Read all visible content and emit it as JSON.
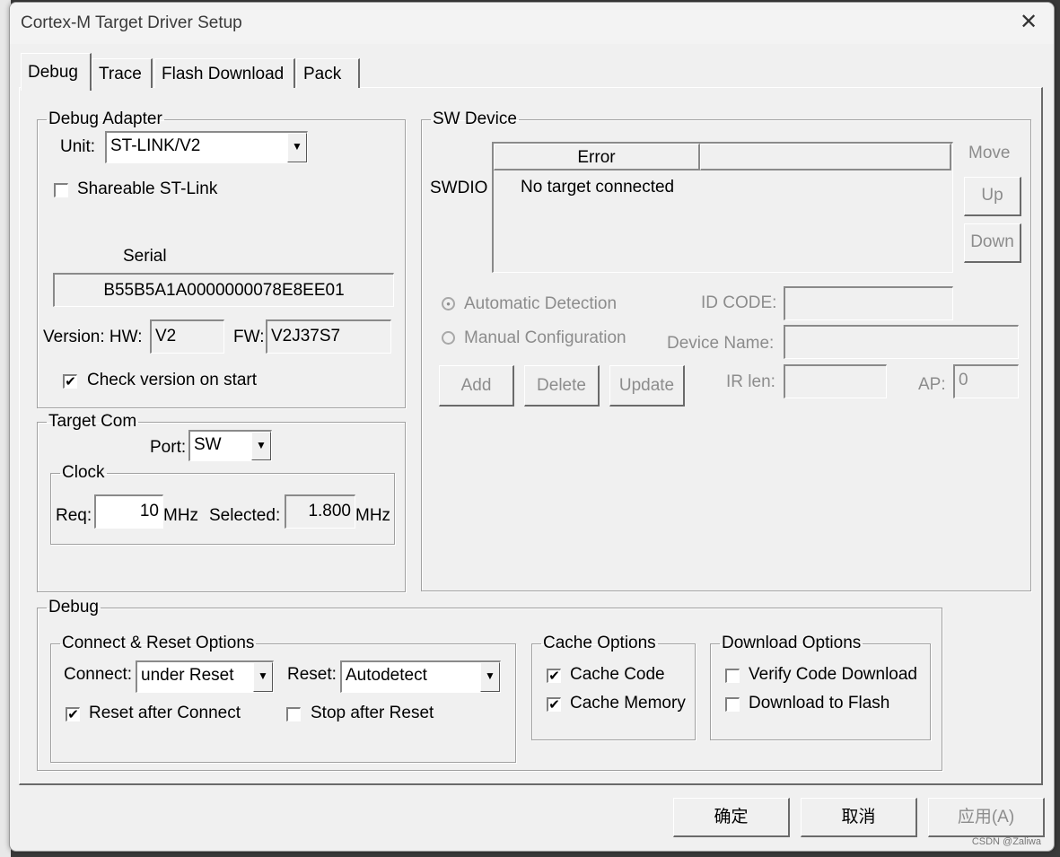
{
  "window": {
    "title": "Cortex-M Target Driver Setup"
  },
  "tabs": [
    {
      "label": "Debug",
      "active": true
    },
    {
      "label": "Trace",
      "active": false
    },
    {
      "label": "Flash Download",
      "active": false
    },
    {
      "label": "Pack",
      "active": false
    }
  ],
  "debug_adapter": {
    "legend": "Debug Adapter",
    "unit_label": "Unit:",
    "unit_value": "ST-LINK/V2",
    "shareable_label": "Shareable ST-Link",
    "shareable_checked": false,
    "serial_label": "Serial",
    "serial_value": "B55B5A1A0000000078E8EE01",
    "version_hw_label": "Version: HW:",
    "hw_value": "V2",
    "fw_label": "FW:",
    "fw_value": "V2J37S7",
    "check_version_label": "Check version on start",
    "check_version_checked": true
  },
  "target_com": {
    "legend": "Target Com",
    "port_label": "Port:",
    "port_value": "SW",
    "clock_legend": "Clock",
    "req_label": "Req:",
    "req_value": "10",
    "mhz_unit": "MHz",
    "selected_label": "Selected:",
    "selected_value": "1.800",
    "selected_unit": "MHz"
  },
  "sw_device": {
    "legend": "SW Device",
    "swdio_label": "SWDIO",
    "column_header": "Error",
    "row_text": "No target connected",
    "move_label": "Move",
    "up_label": "Up",
    "down_label": "Down",
    "auto_detect_label": "Automatic Detection",
    "manual_config_label": "Manual Configuration",
    "id_code_label": "ID CODE:",
    "device_name_label": "Device Name:",
    "ir_len_label": "IR len:",
    "ap_label": "AP:",
    "ap_value": "0",
    "add_label": "Add",
    "delete_label": "Delete",
    "update_label": "Update"
  },
  "debug": {
    "legend": "Debug",
    "connect_reset": {
      "legend": "Connect & Reset Options",
      "connect_label": "Connect:",
      "connect_value": "under Reset",
      "reset_label": "Reset:",
      "reset_value": "Autodetect",
      "reset_after_connect_label": "Reset after Connect",
      "reset_after_connect_checked": true,
      "stop_after_reset_label": "Stop after Reset",
      "stop_after_reset_checked": false
    },
    "cache": {
      "legend": "Cache Options",
      "code_label": "Cache Code",
      "code_checked": true,
      "memory_label": "Cache Memory",
      "memory_checked": true
    },
    "download": {
      "legend": "Download Options",
      "verify_label": "Verify Code Download",
      "verify_checked": false,
      "flash_label": "Download to Flash",
      "flash_checked": false
    }
  },
  "buttons": {
    "ok": "确定",
    "cancel": "取消",
    "apply": "应用(A)"
  },
  "watermark": "CSDN @Zaliwa",
  "check_mark": "✔",
  "arrow_glyph": "▼",
  "close_glyph": "✕",
  "radio_dot": "●"
}
